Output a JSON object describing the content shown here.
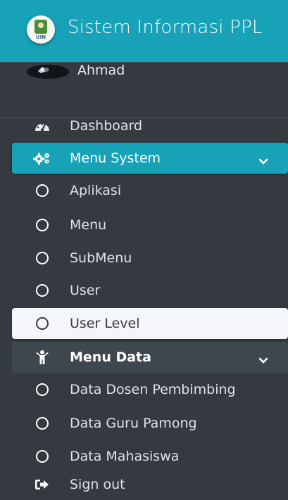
{
  "brand": {
    "title": "Sistem Informasi PPL",
    "logo_text": "UIN"
  },
  "user": {
    "name": "Ahmad"
  },
  "nav": {
    "dashboard": "Dashboard",
    "menu_system": "Menu System",
    "aplikasi": "Aplikasi",
    "menu": "Menu",
    "submenu": "SubMenu",
    "user": "User",
    "user_level": "User Level",
    "menu_data": "Menu Data",
    "data_dosen": "Data Dosen Pembimbing",
    "data_guru": "Data Guru Pamong",
    "data_mahasiswa": "Data Mahasiswa",
    "sign_out": "Sign out"
  },
  "colors": {
    "sidebar_bg": "#343a40",
    "brand_bg": "#17a2b8",
    "active_bg": "#17a2b8",
    "light_active_bg": "#f4f6f9"
  },
  "icons": {
    "dashboard": "tachometer-icon",
    "menu_system": "cogs-icon",
    "menu_data": "child-icon",
    "sign_out": "sign-out-icon",
    "submenu_item": "circle-outline-icon",
    "expand": "chevron-down-icon"
  }
}
